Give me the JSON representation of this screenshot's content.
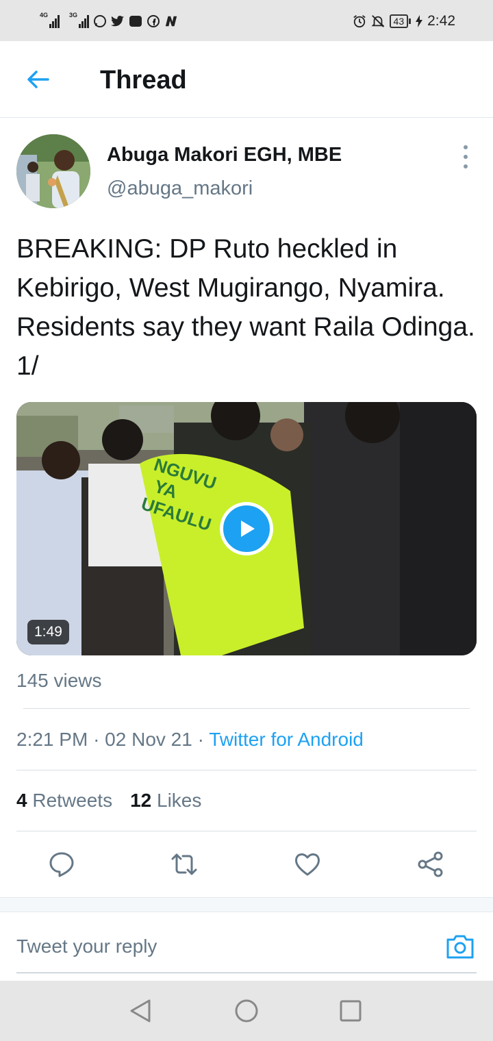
{
  "status_bar": {
    "network_1": "4G",
    "network_2": "3G",
    "battery": "43",
    "time": "2:42",
    "left_icons": [
      "signal-icon",
      "signal-icon",
      "whatsapp-icon",
      "twitter-icon",
      "huawei-icon",
      "facebook-icon",
      "n-app-icon"
    ],
    "right_icons": [
      "alarm-icon",
      "mute-icon",
      "battery-icon",
      "charging-icon"
    ]
  },
  "header": {
    "title": "Thread"
  },
  "tweet": {
    "author_name": "Abuga Makori EGH, MBE",
    "author_handle": "@abuga_makori",
    "text": "BREAKING: DP Ruto heckled in Kebirigo, West Mugirango, Nyamira. Residents say they want Raila Odinga. 1/",
    "video": {
      "duration": "1:49",
      "vest_text": [
        "NGUVU",
        "YA",
        "UFAULU"
      ]
    },
    "views": "145 views",
    "time": "2:21 PM",
    "date": "02 Nov 21",
    "separator": "·",
    "client": "Twitter for Android",
    "retweets_count": "4",
    "retweets_label": "Retweets",
    "likes_count": "12",
    "likes_label": "Likes"
  },
  "reply": {
    "placeholder": "Tweet your reply"
  },
  "colors": {
    "accent": "#1da1f2",
    "text": "#14171a",
    "secondary": "#657786"
  }
}
